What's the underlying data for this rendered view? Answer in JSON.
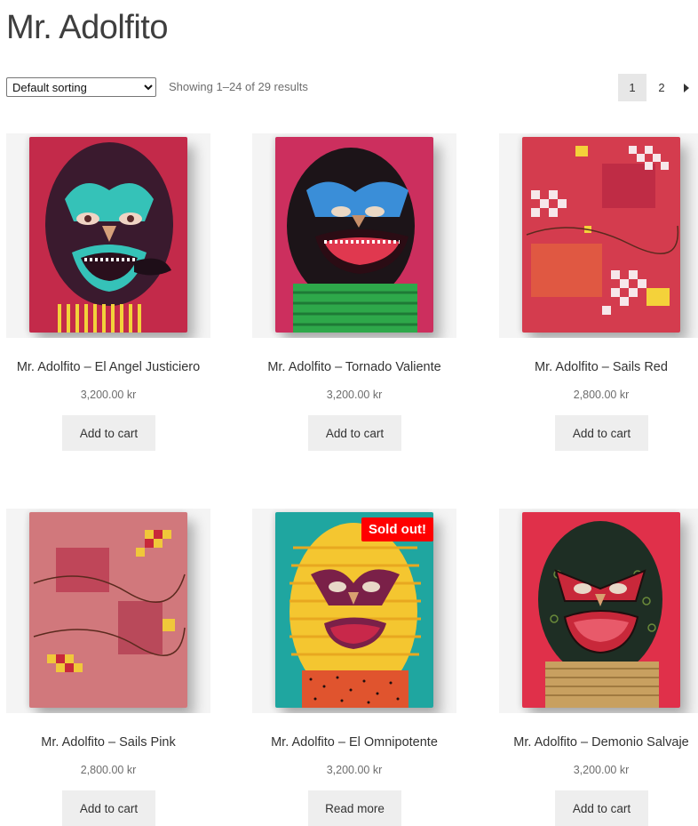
{
  "page": {
    "title": "Mr. Adolfito"
  },
  "toolbar": {
    "sort_selected": "Default sorting",
    "result_count": "Showing 1–24 of 29 results"
  },
  "pagination": {
    "pages": [
      "1",
      "2"
    ],
    "current": "1",
    "next_icon": "arrow-right-icon"
  },
  "products": [
    {
      "title": "Mr. Adolfito – El Angel Justiciero",
      "price": "3,200.00 kr",
      "button": "Add to cart",
      "badge": ""
    },
    {
      "title": "Mr. Adolfito – Tornado Valiente",
      "price": "3,200.00 kr",
      "button": "Add to cart",
      "badge": ""
    },
    {
      "title": "Mr. Adolfito – Sails Red",
      "price": "2,800.00 kr",
      "button": "Add to cart",
      "badge": ""
    },
    {
      "title": "Mr. Adolfito – Sails Pink",
      "price": "2,800.00 kr",
      "button": "Add to cart",
      "badge": ""
    },
    {
      "title": "Mr. Adolfito – El Omnipotente",
      "price": "3,200.00 kr",
      "button": "Read more",
      "badge": "Sold out!"
    },
    {
      "title": "Mr. Adolfito – Demonio Salvaje",
      "price": "3,200.00 kr",
      "button": "Add to cart",
      "badge": ""
    }
  ],
  "colors": {
    "badge_bg": "#ff0000",
    "button_bg": "#eeeeee",
    "current_page_bg": "#e7e7e7"
  }
}
